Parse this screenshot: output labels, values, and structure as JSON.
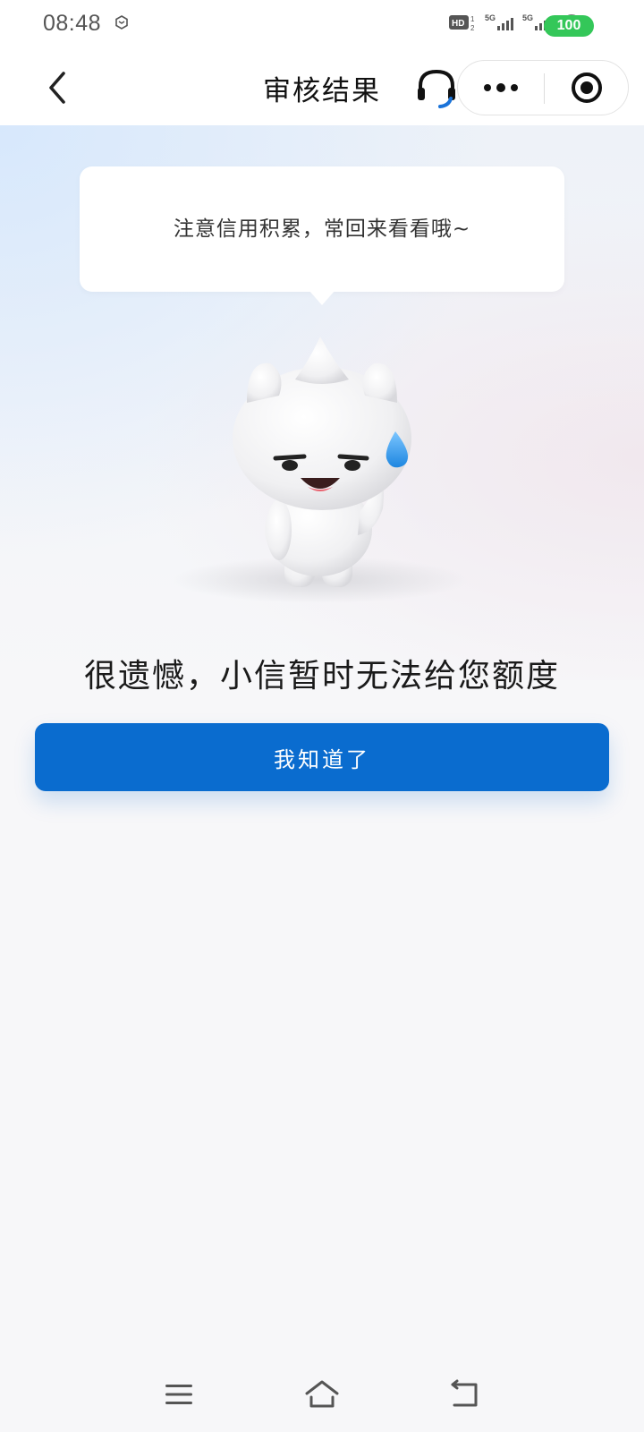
{
  "status_bar": {
    "time": "08:48",
    "battery": "100",
    "icons": [
      "app-notification-icon",
      "hd-icon",
      "signal-5g-icon",
      "signal-5g-icon",
      "wifi-icon",
      "battery-icon"
    ]
  },
  "nav": {
    "title": "审核结果",
    "icons": [
      "back-arrow-icon",
      "headset-icon",
      "more-dots-icon",
      "target-close-icon"
    ]
  },
  "hero": {
    "bubble_text": "注意信用积累，常回来看看哦~",
    "mascot": "cat-mascot-sweat"
  },
  "result": {
    "message": "很遗憾，小信暂时无法给您额度",
    "button_label": "我知道了"
  },
  "colors": {
    "primary": "#0a6ccf",
    "battery": "#34c759",
    "sweat_drop": "#2f9be8"
  },
  "system_nav": {
    "icons": [
      "menu-icon",
      "home-icon",
      "back-icon"
    ]
  }
}
